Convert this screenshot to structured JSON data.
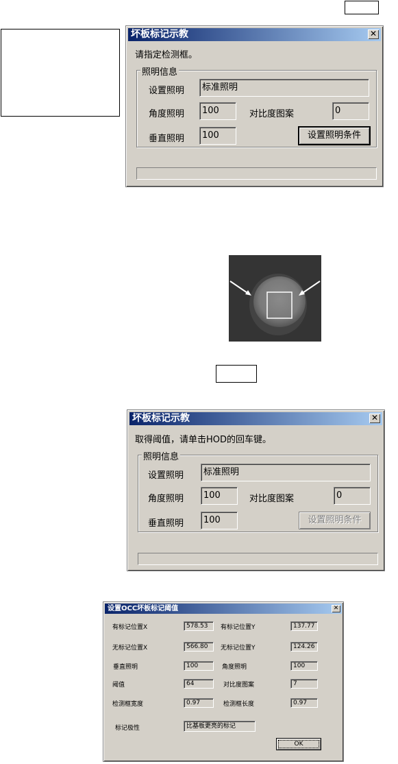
{
  "dialog1": {
    "title": "坏板标记示教",
    "close": "✕",
    "message": "请指定检测框。",
    "group_label": "照明信息",
    "set_light_label": "设置照明",
    "set_light_value": "标准照明",
    "angle_label": "角度照明",
    "angle_value": "100",
    "contrast_label": "对比度图案",
    "contrast_value": "0",
    "vertical_label": "垂直照明",
    "vertical_value": "100",
    "button": "设置照明条件"
  },
  "dialog2": {
    "title": "坏板标记示教",
    "close": "✕",
    "message": "取得阈值，请单击HOD的回车键。",
    "group_label": "照明信息",
    "set_light_label": "设置照明",
    "set_light_value": "标准照明",
    "angle_label": "角度照明",
    "angle_value": "100",
    "contrast_label": "对比度图案",
    "contrast_value": "0",
    "vertical_label": "垂直照明",
    "vertical_value": "100",
    "button": "设置照明条件"
  },
  "dialog3": {
    "title": "设置OCC坏板标记阈值",
    "close": "✕",
    "with_mark_x_label": "有标记位置X",
    "with_mark_x_value": "578.53",
    "with_mark_y_label": "有标记位置Y",
    "with_mark_y_value": "137.77",
    "no_mark_x_label": "无标记位置X",
    "no_mark_x_value": "566.80",
    "no_mark_y_label": "无标记位置Y",
    "no_mark_y_value": "124.26",
    "vertical_label": "垂直照明",
    "vertical_value": "100",
    "angle_label": "角度照明",
    "angle_value": "100",
    "threshold_label": "阈值",
    "threshold_value": "64",
    "contrast_label": "对比度图案",
    "contrast_value": "7",
    "frame_width_label": "检测框宽度",
    "frame_width_value": "0.97",
    "frame_length_label": "检测框长度",
    "frame_length_value": "0.97",
    "polarity_label": "标记极性",
    "polarity_value": "比基板更亮的标记",
    "ok_button": "OK"
  },
  "colors": {
    "dialog_bg": "#d4d0c8",
    "title_start": "#0a246a",
    "title_end": "#a6caf0",
    "camera_bg": "#3a3a3a"
  },
  "icons": {
    "close": "close-icon",
    "arrows": "arrow-icon"
  }
}
